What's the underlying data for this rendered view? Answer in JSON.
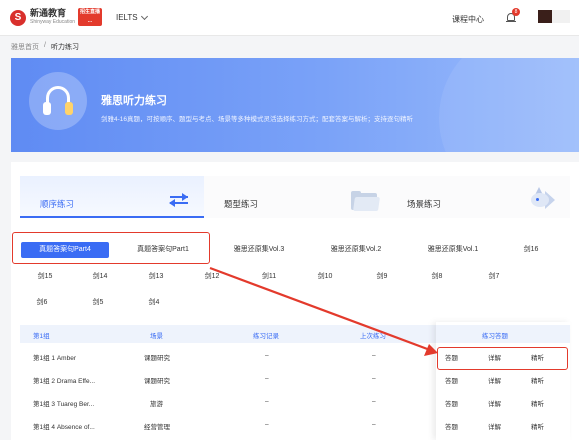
{
  "nav": {
    "logo_cn": "新通教育",
    "logo_en": "Shinyway Education",
    "logo_badge": "招生直播 ...",
    "exam": "IELTS",
    "course_center": "课程中心",
    "notification_count": "8"
  },
  "breadcrumb": {
    "home": "雅思首页",
    "sep": "/",
    "current": "听力练习"
  },
  "banner": {
    "title": "雅思听力练习",
    "subtitle": "剑雅4-16真题，可按顺序、题型与考点、场景等多种模式灵活选择练习方式；配套答案与解析；支持逐句精听"
  },
  "tabs": [
    {
      "label": "顺序练习"
    },
    {
      "label": "题型练习"
    },
    {
      "label": "场景练习"
    }
  ],
  "chips": {
    "row1": [
      "真题答案句Part4",
      "真题答案句Part1",
      "雅思还原集Vol.3",
      "雅思还原集Vol.2",
      "雅思还原集Vol.1",
      "剑16"
    ],
    "row2": [
      "剑15",
      "剑14",
      "剑13",
      "剑12",
      "剑11",
      "剑10",
      "剑9",
      "剑8",
      "剑7"
    ],
    "row3": [
      "剑6",
      "剑5",
      "剑4"
    ]
  },
  "table": {
    "headers": [
      "第1组",
      "场景",
      "练习记录",
      "上次练习",
      "练习答题"
    ],
    "rows": [
      {
        "name": "第1组 1 Amber",
        "scene": "课题研究",
        "record": "–",
        "last": "–"
      },
      {
        "name": "第1组 2 Drama Effe...",
        "scene": "课题研究",
        "record": "–",
        "last": "–"
      },
      {
        "name": "第1组 3 Tuareg Ber...",
        "scene": "旅游",
        "record": "–",
        "last": "–"
      },
      {
        "name": "第1组 4 Absence of...",
        "scene": "经营管理",
        "record": "–",
        "last": "–"
      }
    ],
    "actions": [
      "答题",
      "详解",
      "精听"
    ]
  },
  "colors": {
    "accent": "#3a6cf4",
    "annotation": "#e33a2c"
  }
}
